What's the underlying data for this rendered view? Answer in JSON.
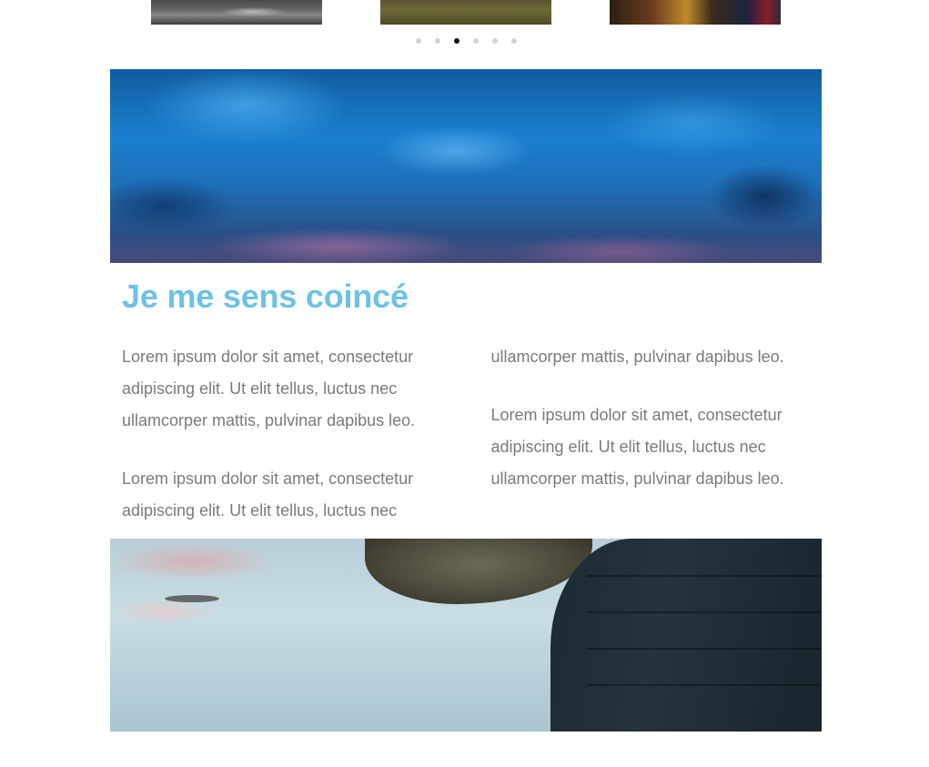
{
  "carousel": {
    "thumbnails": [
      {
        "description": "grey road"
      },
      {
        "description": "olive field"
      },
      {
        "description": "city lights"
      }
    ],
    "dots_count": 6,
    "active_dot_index": 2
  },
  "article": {
    "heading": "Je me sens coincé",
    "paragraphs": [
      "Lorem ipsum dolor sit amet, consectetur adipiscing elit. Ut elit tellus, luctus nec ullamcorper mattis, pulvinar dapibus leo.",
      "Lorem ipsum dolor sit amet, consectetur adipiscing elit. Ut elit tellus, luctus nec ullamcorper mattis, pulvinar dapibus leo.",
      "Lorem ipsum dolor sit amet, consectetur adipiscing elit. Ut elit tellus, luctus nec ullamcorper mattis, pulvinar dapibus leo."
    ],
    "heading_color": "#6ec1e4",
    "text_color": "#7a7a7a"
  },
  "images": {
    "hero": "blue cloudy sky",
    "bottom": "person in dark puffer jacket near water and rock"
  }
}
